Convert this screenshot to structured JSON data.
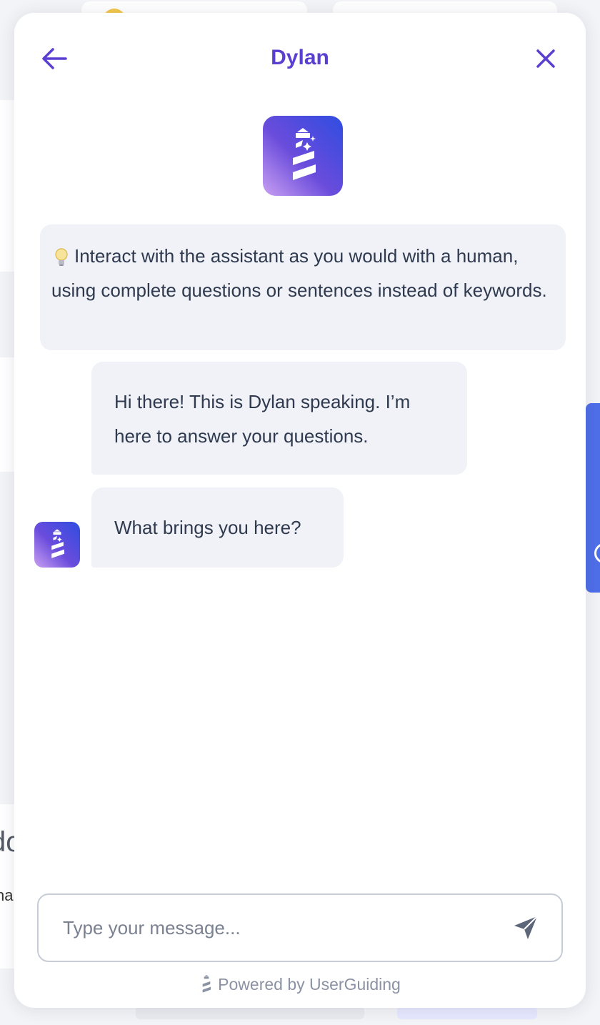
{
  "header": {
    "title": "Dylan",
    "back_icon": "arrow-left-icon",
    "close_icon": "close-icon"
  },
  "tip": {
    "icon": "lightbulb-icon",
    "text": "Interact with the assistant as you would with a human, using complete questions or sentences instead of keywords."
  },
  "messages": [
    {
      "sender": "Dylan",
      "text": "Hi there! This is Dylan speaking. I’m here to answer your questions."
    },
    {
      "sender": "Dylan",
      "text": "What brings you here?"
    }
  ],
  "composer": {
    "placeholder": "Type your message...",
    "value": "",
    "send_icon": "send-icon"
  },
  "footer": {
    "powered_by": "Powered by UserGuiding"
  },
  "colors": {
    "accent": "#5a3fd1",
    "bubble_bg": "#f0f2f7",
    "text": "#2f3a4f",
    "muted": "#8b92a3"
  }
}
